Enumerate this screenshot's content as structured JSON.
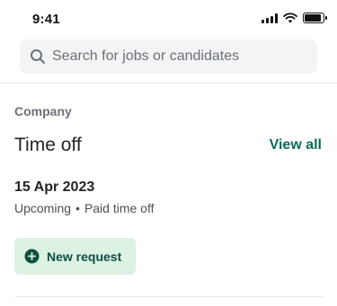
{
  "status_bar": {
    "time": "9:41",
    "icons": [
      "signal-icon",
      "wifi-icon",
      "battery-icon"
    ],
    "battery_level": 0.9
  },
  "search": {
    "placeholder": "Search for jobs or candidates",
    "value": "",
    "icon": "search-icon"
  },
  "section": {
    "label": "Company",
    "title": "Time off",
    "view_all_label": "View all"
  },
  "entry": {
    "date": "15 Apr 2023",
    "status": "Upcoming",
    "separator": "•",
    "type": "Paid time off"
  },
  "actions": {
    "new_request_label": "New request",
    "new_request_icon": "plus-circle-icon"
  },
  "colors": {
    "accent": "#0a6b5a",
    "button_bg": "#dcf2e3",
    "button_text": "#0d4d3f",
    "search_bg": "#f3f4f5"
  }
}
